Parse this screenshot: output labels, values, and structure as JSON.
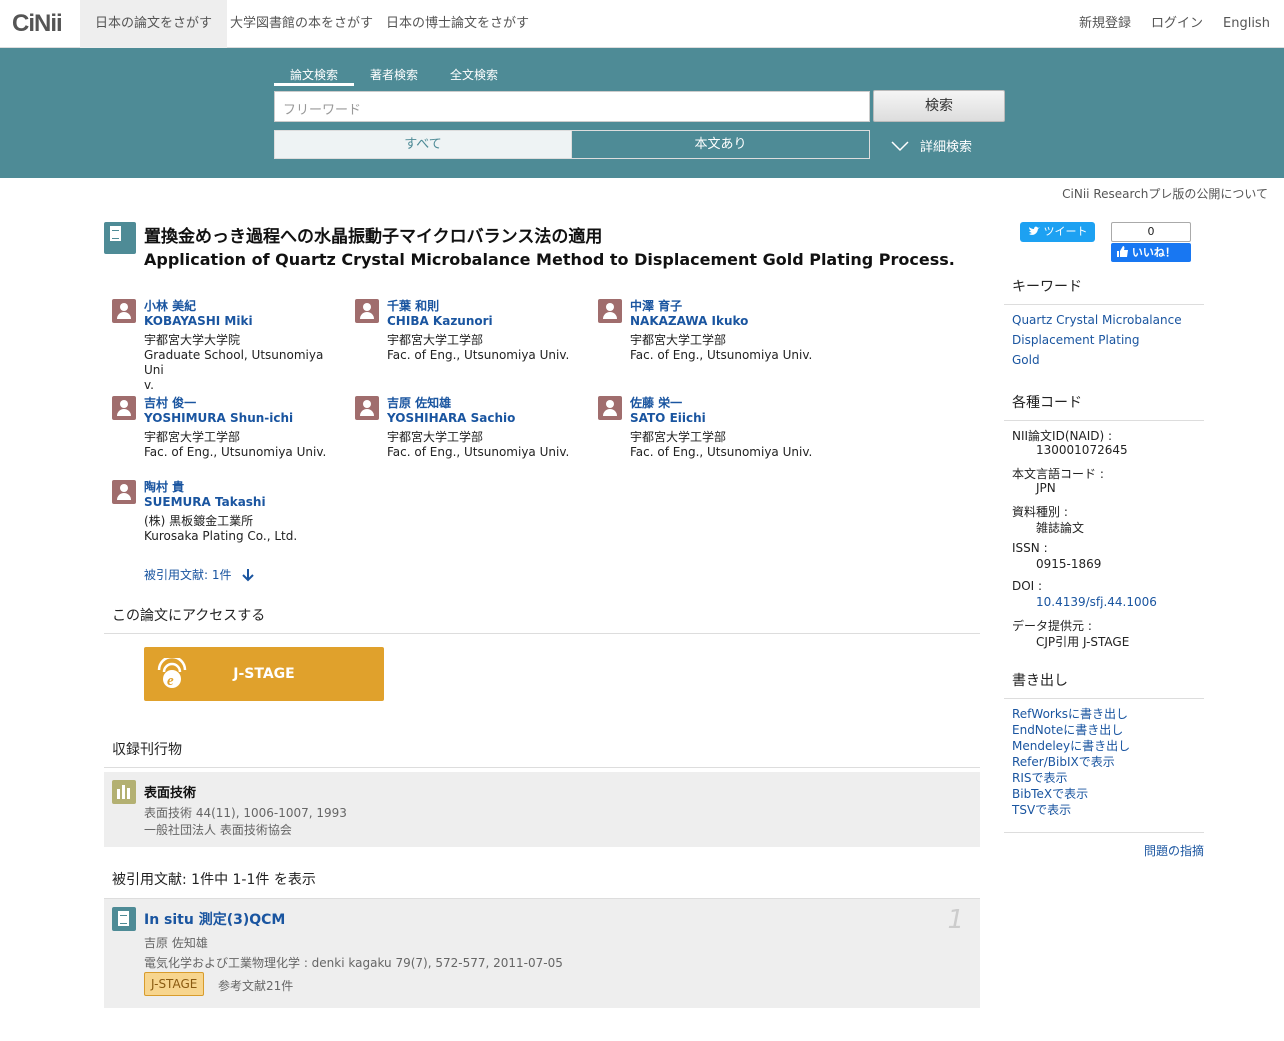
{
  "header": {
    "logo": "CiNii",
    "tabs": [
      "日本の論文をさがす",
      "大学図書館の本をさがす",
      "日本の博士論文をさがす"
    ],
    "right_links": [
      "新規登録",
      "ログイン",
      "English"
    ]
  },
  "search": {
    "tabs": [
      "論文検索",
      "著者検索",
      "全文検索"
    ],
    "placeholder": "フリーワード",
    "button": "検索",
    "filter_all": "すべて",
    "filter_fulltext": "本文あり",
    "advanced": "詳細検索"
  },
  "notice": "CiNii Researchプレ版の公開について",
  "article": {
    "title_ja": "置換金めっき過程への水晶振動子マイクロバランス法の適用",
    "title_en": "Application of Quartz Crystal Microbalance Method to Displacement Gold Plating Process.",
    "authors": [
      {
        "ja": "小林 美紀",
        "en": "KOBAYASHI Miki",
        "aff_ja": "宇都宮大学大学院",
        "aff_en": "Graduate School, Utsunomiya Uni",
        "aff_en2": "v."
      },
      {
        "ja": "千葉 和則",
        "en": "CHIBA Kazunori",
        "aff_ja": "宇都宮大学工学部",
        "aff_en": "Fac. of Eng., Utsunomiya Univ.",
        "aff_en2": ""
      },
      {
        "ja": "中澤 育子",
        "en": "NAKAZAWA Ikuko",
        "aff_ja": "宇都宮大学工学部",
        "aff_en": "Fac. of Eng., Utsunomiya Univ.",
        "aff_en2": ""
      },
      {
        "ja": "吉村 俊一",
        "en": "YOSHIMURA Shun-ichi",
        "aff_ja": "宇都宮大学工学部",
        "aff_en": "Fac. of Eng., Utsunomiya Univ.",
        "aff_en2": ""
      },
      {
        "ja": "吉原 佐知雄",
        "en": "YOSHIHARA Sachio",
        "aff_ja": "宇都宮大学工学部",
        "aff_en": "Fac. of Eng., Utsunomiya Univ.",
        "aff_en2": ""
      },
      {
        "ja": "佐藤 栄一",
        "en": "SATO Eiichi",
        "aff_ja": "宇都宮大学工学部",
        "aff_en": "Fac. of Eng., Utsunomiya Univ.",
        "aff_en2": ""
      },
      {
        "ja": "陶村 貴",
        "en": "SUEMURA Takashi",
        "aff_ja": "(株) 黒板鍍金工業所",
        "aff_en": "Kurosaka Plating Co., Ltd.",
        "aff_en2": ""
      }
    ],
    "cited_count_link": "被引用文献: 1件",
    "access_heading": "この論文にアクセスする",
    "jstage_label": "J-STAGE",
    "journal_heading": "収録刊行物",
    "journal_name": "表面技術",
    "journal_detail": "表面技術 44(11), 1006-1007, 1993",
    "journal_publisher": "一般社団法人 表面技術協会",
    "cited_heading": "被引用文献:  1件中 1-1件 を表示",
    "cited_item": {
      "number": "1",
      "title": "In situ 測定(3)QCM",
      "author": "吉原 佐知雄",
      "source": "電気化学および工業物理化学 : denki kagaku 79(7), 572-577, 2011-07-05",
      "badge": "J-STAGE",
      "refs": "参考文献21件"
    }
  },
  "sidebar": {
    "tweet": "ツイート",
    "like_count": "0",
    "like": "いいね！",
    "keywords_heading": "キーワード",
    "keywords": [
      "Quartz Crystal Microbalance",
      "Displacement Plating",
      "Gold"
    ],
    "codes_heading": "各種コード",
    "codes": [
      {
        "label": "NII論文ID(NAID) :",
        "value": "130001072645"
      },
      {
        "label": "本文言語コード :",
        "value": "JPN"
      },
      {
        "label": "資料種別 :",
        "value": "雑誌論文"
      },
      {
        "label": "ISSN :",
        "value": "0915-1869"
      },
      {
        "label": "DOI :",
        "value": "10.4139/sfj.44.1006"
      },
      {
        "label": "データ提供元 :",
        "value": "CJP引用  J-STAGE"
      }
    ],
    "export_heading": "書き出し",
    "exports": [
      "RefWorksに書き出し",
      "EndNoteに書き出し",
      "Mendeleyに書き出し",
      "Refer/BibIXで表示",
      "RISで表示",
      "BibTeXで表示",
      "TSVで表示"
    ],
    "report": "問題の指摘"
  }
}
